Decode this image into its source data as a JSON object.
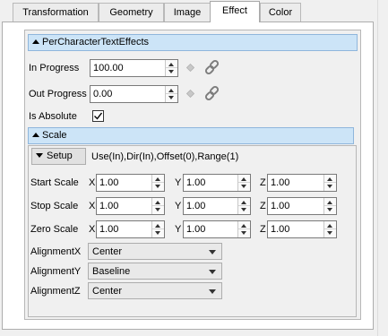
{
  "tabs": [
    {
      "label": "Transformation"
    },
    {
      "label": "Geometry"
    },
    {
      "label": "Image"
    },
    {
      "label": "Effect"
    },
    {
      "label": "Color"
    }
  ],
  "active_tab": "Effect",
  "effect": {
    "header": "PerCharacterTextEffects",
    "in_progress": {
      "label": "In Progress",
      "value": "100.00"
    },
    "out_progress": {
      "label": "Out Progress",
      "value": "0.00"
    },
    "is_absolute": {
      "label": "Is Absolute",
      "checked": true
    },
    "scale": {
      "header": "Scale",
      "setup_label": "Setup",
      "setup_summary": "Use(In),Dir(In),Offset(0),Range(1)",
      "axis_x": "X",
      "axis_y": "Y",
      "axis_z": "Z",
      "rows": [
        {
          "label": "Start Scale",
          "x": "1.00",
          "y": "1.00",
          "z": "1.00"
        },
        {
          "label": "Stop Scale",
          "x": "1.00",
          "y": "1.00",
          "z": "1.00"
        },
        {
          "label": "Zero Scale",
          "x": "1.00",
          "y": "1.00",
          "z": "1.00"
        }
      ],
      "alignment_x": {
        "label": "AlignmentX",
        "value": "Center"
      },
      "alignment_y": {
        "label": "AlignmentY",
        "value": "Baseline"
      },
      "alignment_z": {
        "label": "AlignmentZ",
        "value": "Center"
      }
    }
  },
  "icons": {
    "keyframe": "diamond-keyframe-icon",
    "link": "chain-link-icon"
  }
}
